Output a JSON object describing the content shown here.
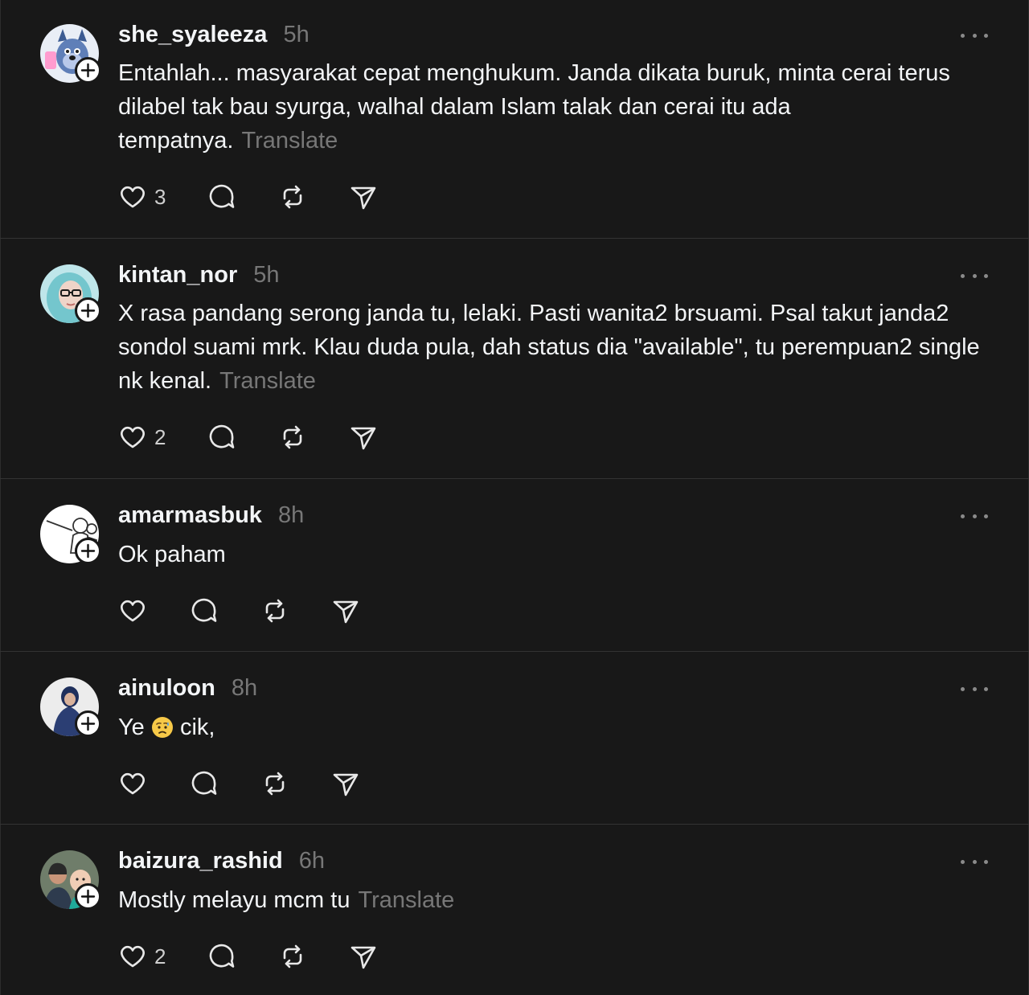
{
  "posts": [
    {
      "username": "she_syaleeza",
      "time": "5h",
      "text": "Entahlah... masyarakat cepat menghukum. Janda dikata buruk, minta cerai terus dilabel tak bau syurga, walhal dalam Islam talak dan cerai itu ada tempatnya.",
      "translate": "Translate",
      "likes": "3"
    },
    {
      "username": "kintan_nor",
      "time": "5h",
      "text": "X rasa pandang serong janda tu, lelaki. Pasti wanita2 brsuami. Psal takut janda2 sondol suami mrk. Klau duda pula, dah status dia \"available\", tu perempuan2 single nk kenal.",
      "translate": "Translate",
      "likes": "2"
    },
    {
      "username": "amarmasbuk",
      "time": "8h",
      "text": "Ok paham",
      "translate": "",
      "likes": ""
    },
    {
      "username": "ainuloon",
      "time": "8h",
      "text_before_emoji": "Ye",
      "text_after_emoji": "cik,",
      "emoji": "sad-but-relieved-face",
      "translate": "",
      "likes": ""
    },
    {
      "username": "baizura_rashid",
      "time": "6h",
      "text": "Mostly melayu mcm tu",
      "translate": "Translate",
      "likes": "2"
    }
  ],
  "icons": [
    "heart-icon",
    "comment-icon",
    "repost-icon",
    "share-icon",
    "more-icon",
    "follow-plus-icon"
  ],
  "colors": {
    "background": "#181818",
    "text": "#f3f5f7",
    "muted": "#777777",
    "divider": "#333333"
  }
}
